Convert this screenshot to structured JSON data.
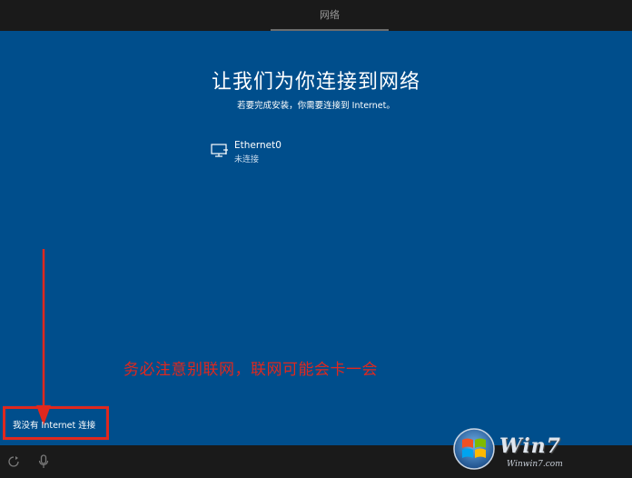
{
  "header": {
    "title": "网络"
  },
  "main": {
    "heading": "让我们为你连接到网络",
    "subheading": "若要完成安装，你需要连接到 Internet。",
    "networks": [
      {
        "name": "Ethernet0",
        "status": "未连接",
        "icon": "ethernet-icon"
      }
    ],
    "no_internet_link": "我没有 Internet 连接"
  },
  "annotation": {
    "text": "务必注意别联网，联网可能会卡一会",
    "color": "#e0281e"
  },
  "footer": {
    "icons": [
      "ease-of-access-icon",
      "microphone-icon"
    ]
  },
  "watermark": {
    "brand": "Win7",
    "url": "Winwin7.com"
  },
  "colors": {
    "background": "#004e8c",
    "bars": "#1a1a1a",
    "accent_red": "#e0281e"
  }
}
